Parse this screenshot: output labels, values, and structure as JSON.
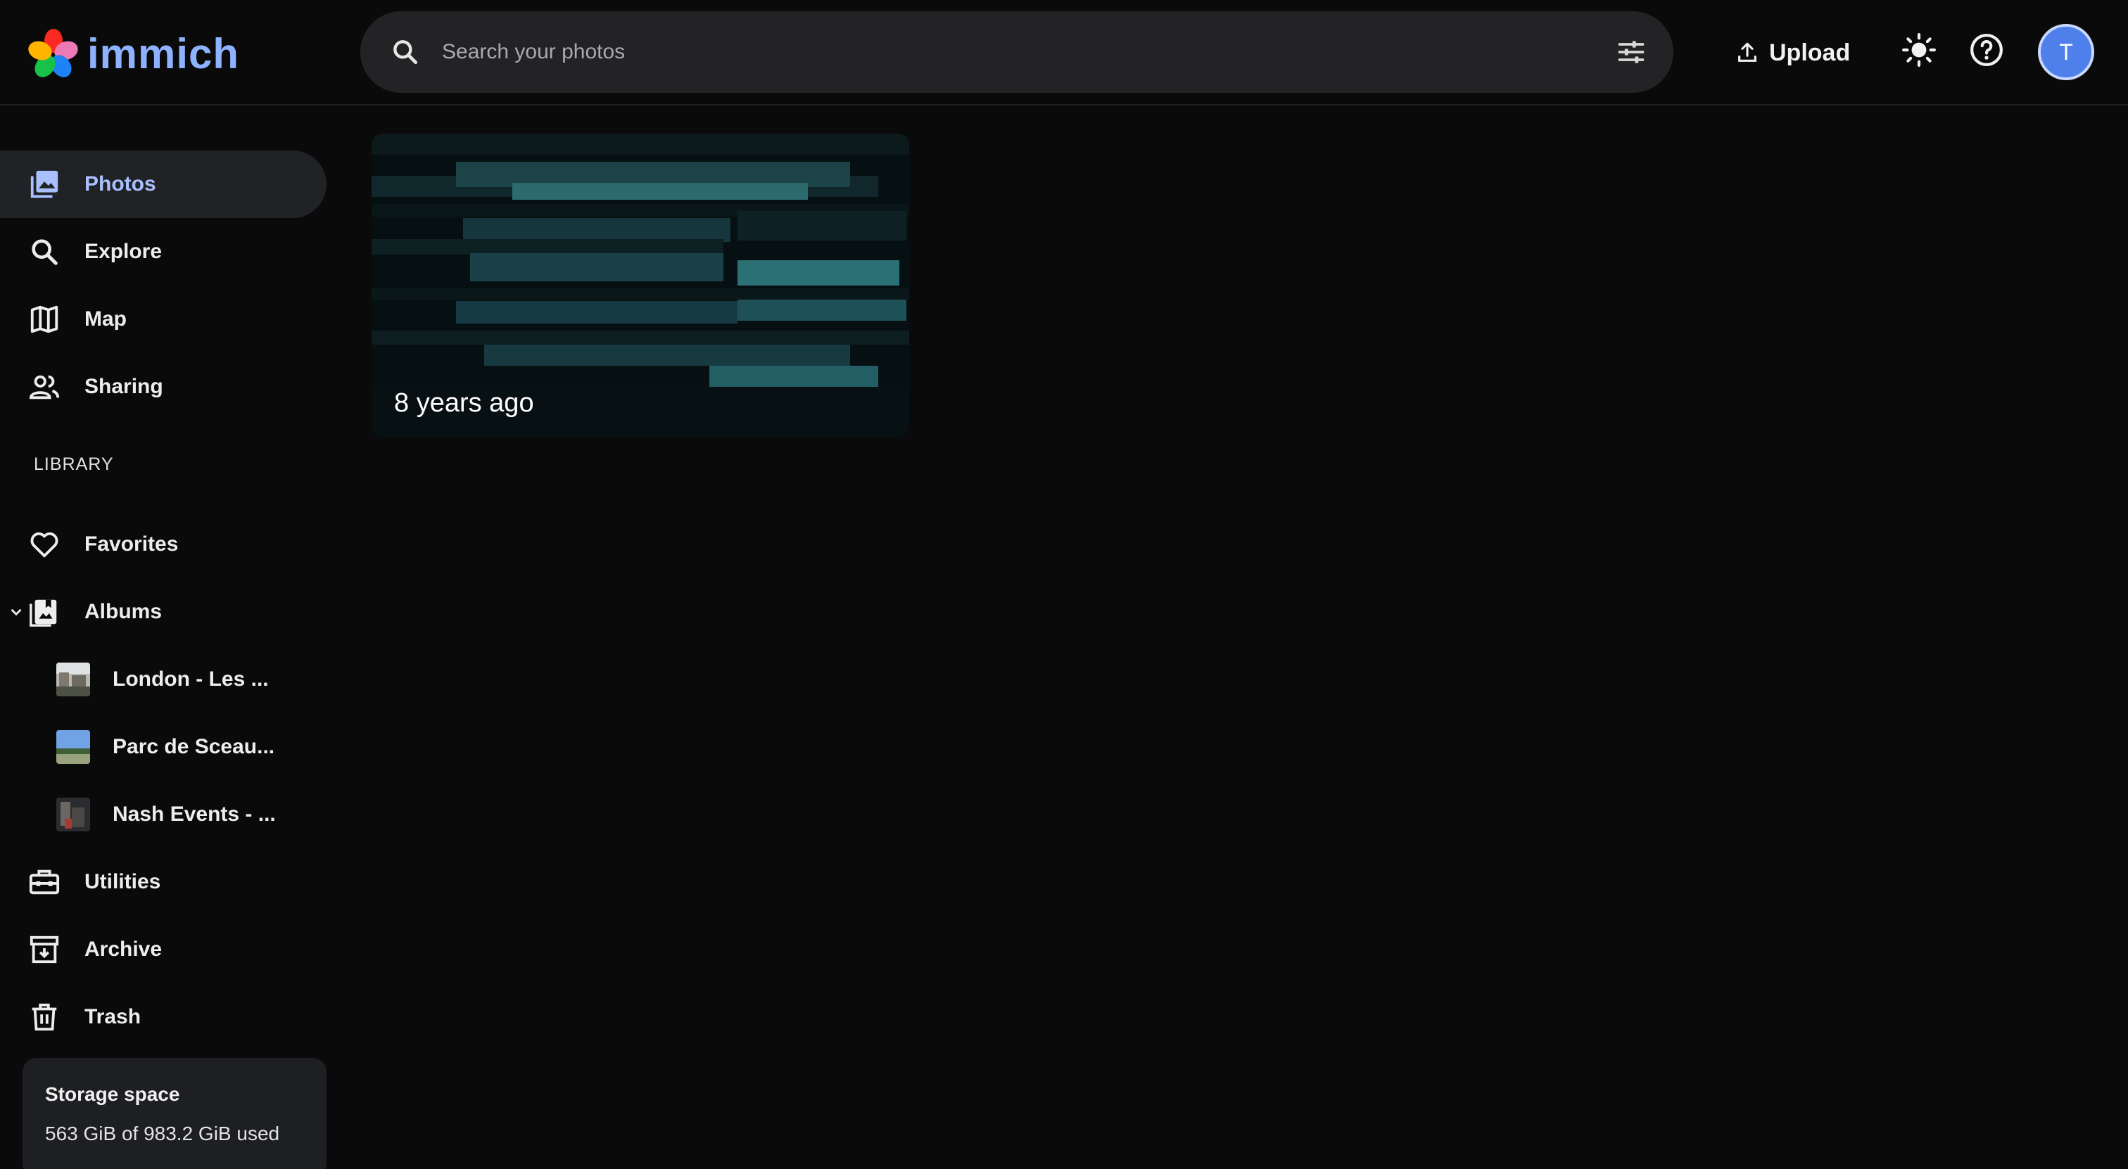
{
  "app": {
    "name": "immich",
    "accent": "#8fb2ff"
  },
  "header": {
    "search_placeholder": "Search your photos",
    "upload_label": "Upload",
    "avatar_initial": "T"
  },
  "sidebar": {
    "nav": [
      {
        "label": "Photos",
        "icon": "photos-icon",
        "active": true
      },
      {
        "label": "Explore",
        "icon": "search-icon"
      },
      {
        "label": "Map",
        "icon": "map-icon"
      },
      {
        "label": "Sharing",
        "icon": "people-icon"
      }
    ],
    "library_label": "LIBRARY",
    "library": [
      {
        "label": "Favorites",
        "icon": "heart-icon"
      },
      {
        "label": "Albums",
        "icon": "album-icon"
      }
    ],
    "albums": [
      {
        "label": "London - Les ..."
      },
      {
        "label": "Parc de Sceau..."
      },
      {
        "label": "Nash Events - ..."
      }
    ],
    "tools": [
      {
        "label": "Utilities",
        "icon": "toolbox-icon"
      },
      {
        "label": "Archive",
        "icon": "archive-icon"
      },
      {
        "label": "Trash",
        "icon": "trash-icon"
      }
    ],
    "storage": {
      "title": "Storage space",
      "usage": "563 GiB of 983.2 GiB used"
    }
  },
  "main": {
    "memory": {
      "caption": "8 years ago"
    }
  }
}
